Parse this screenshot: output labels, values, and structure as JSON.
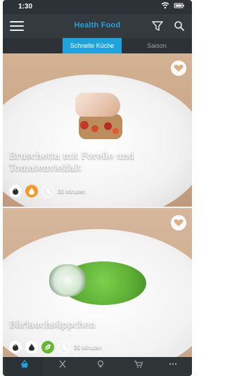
{
  "status": {
    "time": "1:30"
  },
  "header": {
    "title": "Health Food"
  },
  "tabs": [
    {
      "label": "Schnelle Küche",
      "active": true
    },
    {
      "label": "Saison",
      "active": false
    }
  ],
  "recipes": [
    {
      "title": "Bruschetta mit Forelle und Tomatenvielfalt",
      "time": "30 Minuten"
    },
    {
      "title": "Bärlauchsüppchen",
      "time": "30 Minuten"
    }
  ],
  "bottom_nav": [
    {
      "label": "",
      "active": true
    },
    {
      "label": "",
      "active": false
    },
    {
      "label": "",
      "active": false
    },
    {
      "label": "",
      "active": false
    },
    {
      "label": "",
      "active": false
    }
  ],
  "colors": {
    "accent": "#1fa3df",
    "app_bar": "#343a3e",
    "tab_inactive": "#9aa1a6",
    "orange": "#f39a2b",
    "green": "#67b62f"
  }
}
